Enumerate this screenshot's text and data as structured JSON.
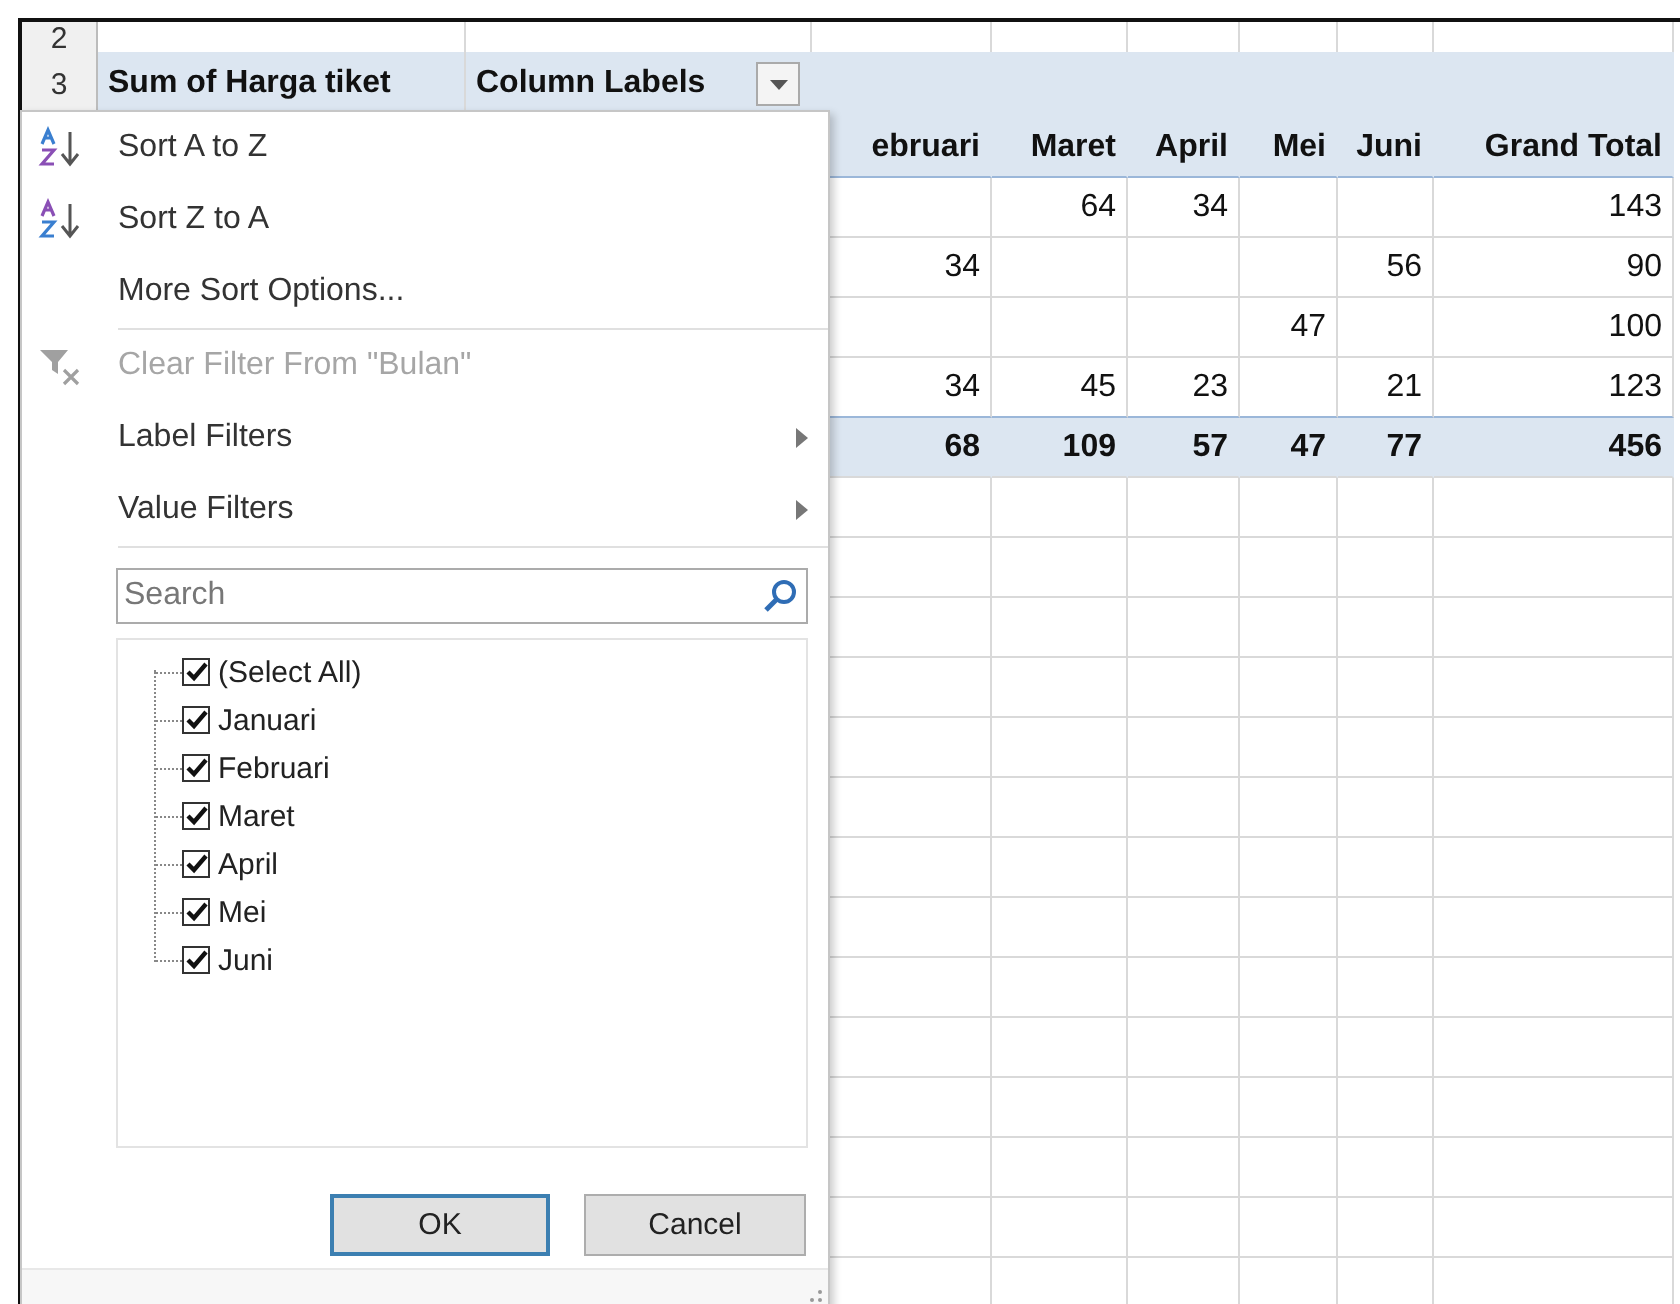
{
  "sheet": {
    "row_headers": [
      "2",
      "3"
    ],
    "pivot": {
      "value_field": "Sum of Harga tiket",
      "column_labels": "Column Labels",
      "columns": [
        "ebruari",
        "Maret",
        "April",
        "Mei",
        "Juni",
        "Grand Total"
      ],
      "rows": [
        {
          "cells": [
            null,
            "64",
            "34",
            null,
            null,
            "143"
          ]
        },
        {
          "cells": [
            "34",
            null,
            null,
            null,
            "56",
            "90"
          ]
        },
        {
          "cells": [
            null,
            null,
            null,
            "47",
            null,
            "100"
          ]
        },
        {
          "cells": [
            "34",
            "45",
            "23",
            null,
            "21",
            "123"
          ]
        }
      ],
      "total": [
        "68",
        "109",
        "57",
        "47",
        "77",
        "456"
      ]
    }
  },
  "filter_menu": {
    "items": [
      {
        "kind": "sort_asc",
        "label": "Sort A to Z",
        "disabled": false
      },
      {
        "kind": "sort_desc",
        "label": "Sort Z to A",
        "disabled": false
      },
      {
        "kind": "plain",
        "label": "More Sort Options...",
        "disabled": false
      },
      {
        "kind": "separator"
      },
      {
        "kind": "clear_filter",
        "label": "Clear Filter From \"Bulan\"",
        "disabled": true
      },
      {
        "kind": "submenu",
        "label": "Label Filters",
        "disabled": false
      },
      {
        "kind": "submenu",
        "label": "Value Filters",
        "disabled": false
      },
      {
        "kind": "separator"
      }
    ],
    "search": {
      "placeholder": "Search"
    },
    "options": [
      {
        "label": "(Select All)",
        "checked": true
      },
      {
        "label": "Januari",
        "checked": true
      },
      {
        "label": "Februari",
        "checked": true
      },
      {
        "label": "Maret",
        "checked": true
      },
      {
        "label": "April",
        "checked": true
      },
      {
        "label": "Mei",
        "checked": true
      },
      {
        "label": "Juni",
        "checked": true
      }
    ],
    "buttons": [
      {
        "label": "OK",
        "default": true
      },
      {
        "label": "Cancel",
        "default": false
      }
    ]
  }
}
